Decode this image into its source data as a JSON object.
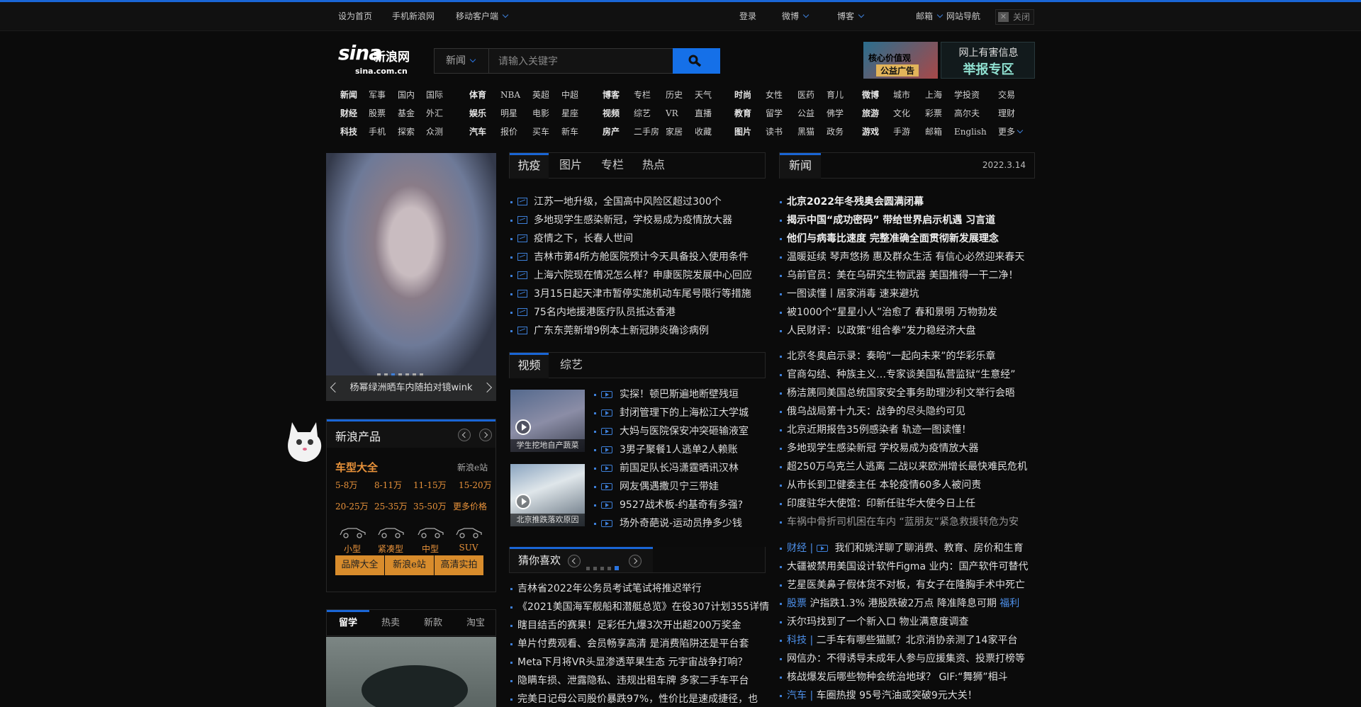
{
  "topbar": {
    "set_home": "设为首页",
    "mobile_site": "手机新浪网",
    "mobile_client": "移动客户端",
    "login": "登录",
    "weibo": "微博",
    "blog": "博客",
    "mail": "邮箱",
    "site_nav": "网站导航",
    "close": "关闭"
  },
  "logo": {
    "brand": "sina",
    "cn": "新浪网",
    "domain": "sina.com.cn"
  },
  "search": {
    "category": "新闻",
    "placeholder": "请输入关键字"
  },
  "ads": {
    "ad1_line1": "核心价值观",
    "ad1_line2": "公益广告",
    "ad2_line1": "网上有害信息",
    "ad2_line2": "举报专区"
  },
  "nav": {
    "g1": [
      [
        "新闻",
        "军事",
        "国内",
        "国际"
      ],
      [
        "财经",
        "股票",
        "基金",
        "外汇"
      ],
      [
        "科技",
        "手机",
        "探索",
        "众测"
      ]
    ],
    "g2": [
      [
        "体育",
        "NBA",
        "英超",
        "中超"
      ],
      [
        "娱乐",
        "明星",
        "电影",
        "星座"
      ],
      [
        "汽车",
        "报价",
        "买车",
        "新车"
      ]
    ],
    "g3": [
      [
        "博客",
        "专栏",
        "历史",
        "天气"
      ],
      [
        "视频",
        "综艺",
        "VR",
        "直播"
      ],
      [
        "房产",
        "二手房",
        "家居",
        "收藏"
      ]
    ],
    "g4": [
      [
        "时尚",
        "女性",
        "医药",
        "育儿"
      ],
      [
        "教育",
        "留学",
        "公益",
        "佛学"
      ],
      [
        "图片",
        "读书",
        "黑猫",
        "政务"
      ]
    ],
    "g5": [
      [
        "微博",
        "城市",
        "上海",
        "学投资"
      ],
      [
        "旅游",
        "文化",
        "彩票",
        "高尔夫"
      ],
      [
        "游戏",
        "手游",
        "邮箱",
        "English"
      ]
    ],
    "g6": [
      "交易",
      "理财",
      "更多"
    ]
  },
  "carousel": {
    "caption": "杨幂绿洲晒车内随拍对镜wink",
    "dots": 7,
    "active_dot": 3
  },
  "tabsA": [
    "抗疫",
    "图片",
    "专栏",
    "热点"
  ],
  "newsA": [
    "江苏一地升级，全国高中风险区超过300个",
    "多地现学生感染新冠，学校易成为疫情放大器",
    "疫情之下，长春人世间",
    "吉林市第4所方舱医院预计今天具备投入使用条件",
    "上海六院现在情况怎么样？申康医院发展中心回应",
    "3月15日起天津市暂停实施机动车尾号限行等措施",
    "75名内地援港医疗队员抵达香港",
    "广东东莞新增9例本土新冠肺炎确诊病例"
  ],
  "tabsV": [
    "视频",
    "综艺"
  ],
  "videos": {
    "thumb1": "学生挖地自产蔬菜",
    "thumb2": "北京推跌落欢原因",
    "items": [
      "实探！顿巴斯遍地断壁残垣",
      "封闭管理下的上海松江大学城",
      "大妈与医院保安冲突砸输液室",
      "3男子聚餐1人逃单2人赖账",
      "前国足队长冯潇霆晒讯汉林",
      "网友偶遇撒贝宁三带娃",
      "9527战术板-约基奇有多强?",
      "场外奇葩说-运动员挣多少钱"
    ]
  },
  "guess": {
    "title": "猜你喜欢",
    "items": [
      "吉林省2022年公务员考试笔试将推迟举行",
      "《2021美国海军舰船和潜艇总览》在役307计划355详情",
      "瞎目结舌的赛果！足彩任九爆3次开出超200万奖金",
      "单片付费观看、会员畅享高清 是消费陷阱还是平台套",
      "Meta下月将VR头显渗透苹果生态 元宇宙战争打响？",
      "隐瞒车损、泄露隐私、违规出租车牌 多家二手车平台",
      "完美日记母公司股价暴跌97%，性价比是速成捷径，也"
    ]
  },
  "newsR": {
    "tab": "新闻",
    "date": "2022.3.14",
    "headlines": [
      "北京2022年冬残奥会圆满闭幕",
      "揭示中国“成功密码” 带给世界启示机遇 习言道",
      "他们与病毒比速度 完整准确全面贯彻新发展理念"
    ],
    "list1": [
      "温暖延续 琴声悠扬 惠及群众生活 有信心必然迎来春天",
      "乌前官员：美在乌研究生物武器 美国推得一干二净！",
      "一图读懂丨居家消毒 速来避坑",
      "被1000个“星星小人”治愈了 春和景明 万物勃发",
      "人民财评：以政策“组合拳”发力稳经济大盘"
    ],
    "list2": [
      "北京冬奥启示录：奏响“一起向未来”的华彩乐章",
      "官商勾结、种族主义…专家谈美国私营监狱“生意经”",
      "杨洁篪同美国总统国家安全事务助理沙利文举行会晤",
      "俄乌战局第十九天：战争的尽头隐约可见",
      "北京近期报告35例感染者 轨迹一图读懂！",
      "多地现学生感染新冠 学校易成为疫情放大器",
      "超250万乌克兰人逃离 二战以来欧洲增长最快难民危机",
      "从市长到卫健委主任 本轮疫情60多人被问责",
      "印度驻华大使馆：印新任驻华大使今日上任",
      "车祸中骨折司机困在车内 “蓝朋友”紧急救援转危为安"
    ],
    "list3": [
      {
        "tag": "财经 |",
        "text": "我们和姚洋聊了聊消费、教育、房价和生育",
        "video": true
      },
      {
        "tag": "",
        "text": "大疆被禁用美国设计软件Figma 业内：国产软件可替代"
      },
      {
        "tag": "",
        "text": "艺星医美鼻子假体货不对板，有女子在隆胸手术中死亡"
      },
      {
        "tag": "股票",
        "text": "沪指跌1.3% 港股跌破2万点 降准降息可期",
        "suffix": "福利"
      },
      {
        "tag": "",
        "text": "沃尔玛找到了一个新入口 物业满意度调查"
      },
      {
        "tag": "科技 |",
        "text": "二手车有哪些猫腻？北京消协亲测了14家平台"
      },
      {
        "tag": "",
        "text": "网信办：不得诱导未成年人参与应援集资、投票打榜等"
      },
      {
        "tag": "",
        "text": "核战爆发后哪些物种会统治地球？ GIF:“舞狮”相斗"
      },
      {
        "tag": "汽车 |",
        "text": "车圈热搜 95号汽油或突破9元大关！"
      }
    ]
  },
  "products": {
    "title": "新浪产品",
    "car_title": "车型大全",
    "car_site": "新浪e站",
    "prices": [
      "5-8万",
      "8-11万",
      "11-15万",
      "15-20万",
      "20-25万",
      "25-35万",
      "35-50万",
      "更多价格"
    ],
    "types": [
      "小型",
      "紧凑型",
      "中型",
      "SUV"
    ],
    "buttons": [
      "品牌大全",
      "新浪e站",
      "高清实拍"
    ]
  },
  "bottom_tabs": [
    "留学",
    "热卖",
    "新款",
    "淘宝"
  ],
  "colors": {
    "accent": "#1a66d6",
    "orange": "#e8923a",
    "background": "#0b0b0b"
  }
}
